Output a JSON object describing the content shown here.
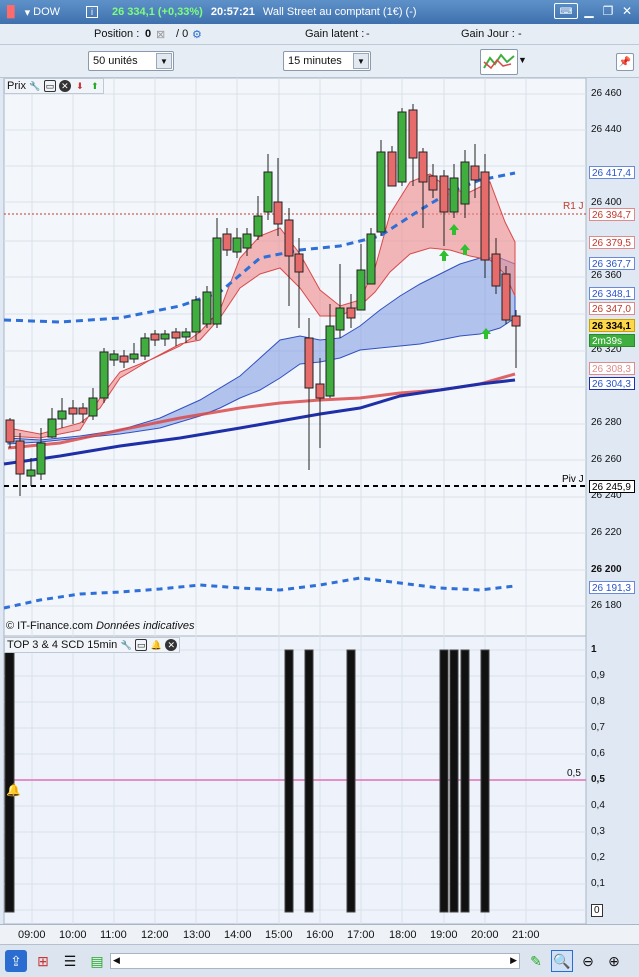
{
  "titlebar": {
    "symbol": "DOW",
    "info_icon": "i",
    "price_change": "26 334,1 (+0,33%)",
    "time": "20:57:21",
    "instrument": "Wall Street au comptant (1€) (-)",
    "icons": [
      "keyboard-icon",
      "minimize-icon",
      "restore-icon",
      "close-icon"
    ]
  },
  "infobar": {
    "position_label": "Position :",
    "position_value": "0",
    "position_slash": "/ 0",
    "gain_latent_label": "Gain latent :",
    "gain_latent_value": "-",
    "gain_jour_label": "Gain Jour :",
    "gain_jour_value": "-"
  },
  "toolbar": {
    "units_select": "50 unités",
    "timeframe_select": "15 minutes"
  },
  "price_panel": {
    "title": "Prix",
    "footer_credit": "© IT-Finance.com",
    "footer_note": "Données indicatives",
    "y_ticks": [
      "26 460",
      "26 440",
      "26 420",
      "26 400",
      "26 380",
      "26 360",
      "26 340",
      "26 320",
      "26 300",
      "26 280",
      "26 260",
      "26 240",
      "26 220",
      "26 200",
      "26 180"
    ],
    "tags": {
      "t1": "26 417,4",
      "t2": "26 394,7",
      "t3": "26 379,5",
      "t4": "26 367,7",
      "t5": "26 348,1",
      "t6": "26 347,0",
      "t7": "26 334,1",
      "t8": "2m39s",
      "t9": "26 308,3",
      "t10": "26 304,3",
      "t11": "26 245,9",
      "t12": "26 191,3"
    },
    "line_labels": {
      "r1": "R1 J",
      "piv": "Piv J"
    }
  },
  "indicator_panel": {
    "title": "TOP 3 & 4 SCD 15min",
    "y_ticks": [
      "1",
      "0,9",
      "0,8",
      "0,7",
      "0,6",
      "0,5",
      "0,4",
      "0,3",
      "0,2",
      "0,1",
      "0"
    ],
    "level_label": "0,5"
  },
  "time_axis": [
    "09:00",
    "10:00",
    "11:00",
    "12:00",
    "13:00",
    "14:00",
    "15:00",
    "16:00",
    "17:00",
    "18:00",
    "19:00",
    "20:00",
    "21:00"
  ],
  "colors": {
    "up": "#3fae3f",
    "down": "#e66b6b",
    "blue": "#1f2fa8",
    "red_ma": "#d94a4a",
    "dash_blue": "#2f6fd8"
  }
}
